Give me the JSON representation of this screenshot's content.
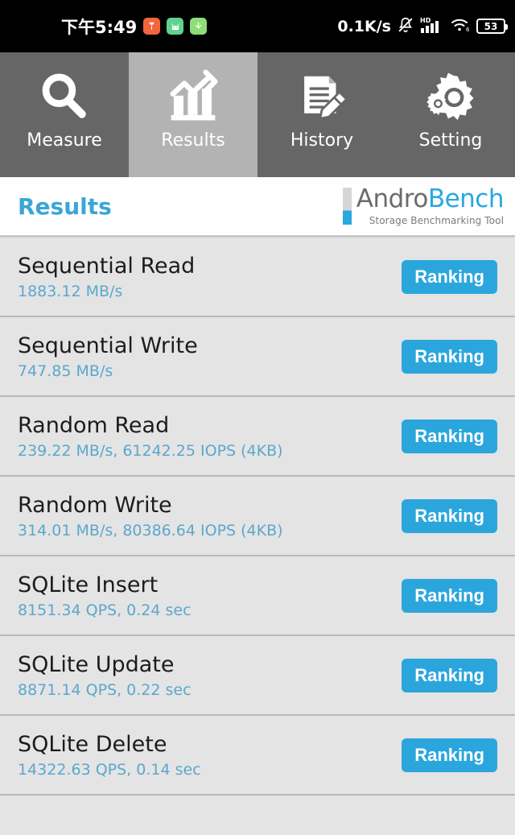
{
  "statusbar": {
    "time": "下午5:49",
    "network_speed": "0.1K/s",
    "hd_label": "HD",
    "battery_level": "53",
    "app_icons": [
      {
        "name": "orange-app-icon",
        "glyph": "♟"
      },
      {
        "name": "android-app-icon",
        "glyph": "◯"
      },
      {
        "name": "download-icon",
        "glyph": "↓"
      }
    ],
    "icons": [
      "mute-bell-icon",
      "signal-bars-icon",
      "wifi-icon",
      "battery-icon"
    ]
  },
  "tabs": [
    {
      "label": "Measure",
      "icon": "magnifier-icon",
      "active": false
    },
    {
      "label": "Results",
      "icon": "bar-chart-arrow-icon",
      "active": true
    },
    {
      "label": "History",
      "icon": "document-pencil-icon",
      "active": false
    },
    {
      "label": "Setting",
      "icon": "gears-icon",
      "active": false
    }
  ],
  "header": {
    "title": "Results",
    "brand_prefix": "Andro",
    "brand_suffix": "Bench",
    "brand_tagline": "Storage Benchmarking Tool"
  },
  "results": [
    {
      "title": "Sequential Read",
      "value": "1883.12 MB/s",
      "button": "Ranking"
    },
    {
      "title": "Sequential Write",
      "value": "747.85 MB/s",
      "button": "Ranking"
    },
    {
      "title": "Random Read",
      "value": "239.22 MB/s, 61242.25 IOPS (4KB)",
      "button": "Ranking"
    },
    {
      "title": "Random Write",
      "value": "314.01 MB/s, 80386.64 IOPS (4KB)",
      "button": "Ranking"
    },
    {
      "title": "SQLite Insert",
      "value": "8151.34 QPS, 0.24 sec",
      "button": "Ranking"
    },
    {
      "title": "SQLite Update",
      "value": "8871.14 QPS, 0.22 sec",
      "button": "Ranking"
    },
    {
      "title": "SQLite Delete",
      "value": "14322.63 QPS, 0.14 sec",
      "button": "Ranking"
    }
  ],
  "colors": {
    "accent_blue": "#2ba6dd",
    "title_blue": "#3aa6d6",
    "value_blue": "#5aa8cd",
    "tab_inactive": "#666666",
    "tab_active": "#b3b3b3",
    "list_bg": "#e4e4e4"
  }
}
